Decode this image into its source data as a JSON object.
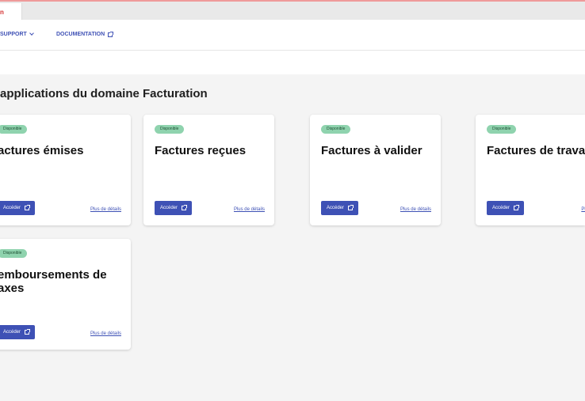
{
  "browser": {
    "tab_label": "n"
  },
  "nav": {
    "support_label": "SUPPORT",
    "documentation_label": "DOCUMENTATION"
  },
  "page": {
    "title": "applications du domaine Facturation"
  },
  "colors": {
    "accent": "#3e51b5",
    "badge_bg": "#8fd3ae",
    "page_bg": "#f4f4f4"
  },
  "cards": [
    {
      "badge": "Disponible",
      "title": "actures émises",
      "button": "Accéder",
      "details": "Plus de détails"
    },
    {
      "badge": "Disponible",
      "title": "Factures reçues",
      "button": "Accéder",
      "details": "Plus de détails"
    },
    {
      "badge": "Disponible",
      "title": "Factures à valider",
      "button": "Accéder",
      "details": "Plus de détails"
    },
    {
      "badge": "Disponible",
      "title": "Factures de trava",
      "button": "Accéder",
      "details": "Plus de détails"
    },
    {
      "badge": "Disponible",
      "title": "emboursements de axes",
      "button": "Accéder",
      "details": "Plus de détails"
    }
  ]
}
